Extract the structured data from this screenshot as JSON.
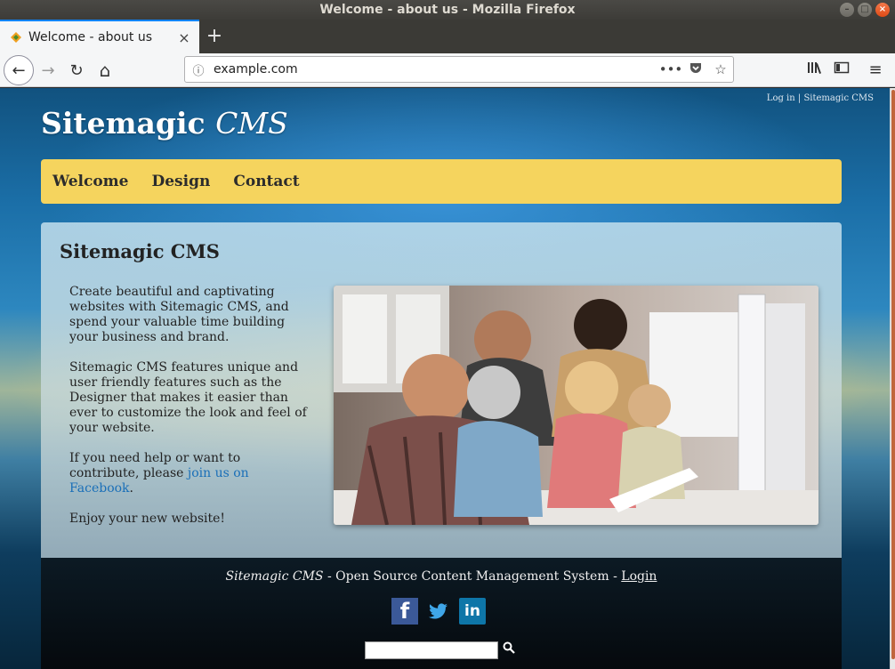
{
  "window": {
    "title": "Welcome - about us - Mozilla Firefox",
    "min_glyph": "–",
    "max_glyph": "□",
    "close_glyph": "×"
  },
  "tab": {
    "title": "Welcome - about us",
    "close_glyph": "×",
    "new_tab_glyph": "+"
  },
  "nav": {
    "back_glyph": "←",
    "forward_glyph": "→",
    "reload_glyph": "↻",
    "home_glyph": "⌂",
    "url": "example.com",
    "info_glyph": "ⓘ",
    "more_glyph": "•••",
    "pocket_glyph": "◡",
    "star_glyph": "☆",
    "library_glyph": "|||\\",
    "sidebar_glyph": "▥",
    "menu_glyph": "≡"
  },
  "page": {
    "login_link": "Log in",
    "separator": "|",
    "sitemagic_link": "Sitemagic CMS",
    "site_title_bold": "Sitemagic",
    "site_title_italic": "CMS",
    "menu": [
      "Welcome",
      "Design",
      "Contact"
    ],
    "content_title": "Sitemagic CMS",
    "paragraph1": "Create beautiful and captivating websites with Sitemagic CMS, and spend your valuable time building your business and brand.",
    "paragraph2": "Sitemagic CMS features unique and user friendly features such as the Designer that makes it easier than ever to customize the look and feel of your website.",
    "paragraph3_prefix": "If you need help or want to contribute, please ",
    "paragraph3_link": "join us on Facebook",
    "paragraph3_suffix": ".",
    "paragraph4": "Enjoy your new website!"
  },
  "footer": {
    "brand": "Sitemagic CMS",
    "tagline": " - Open Source Content Management System - ",
    "login": "Login",
    "search_value": "",
    "search_glyph": "⚲"
  },
  "icons": {
    "facebook": "f",
    "twitter": "🐦",
    "linkedin": "in"
  }
}
